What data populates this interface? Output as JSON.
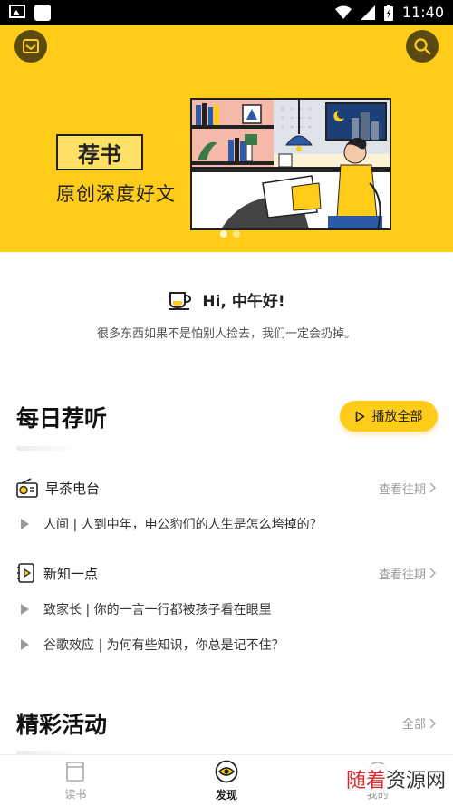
{
  "status_bar": {
    "time": "11:40"
  },
  "banner": {
    "title": "荐书",
    "subtitle": "原创深度好文",
    "colors": {
      "bg": "#FFCC1A",
      "icon_bg": "#5a4a12"
    }
  },
  "greeting": {
    "title": "Hi, 中午好!",
    "subtitle": "很多东西如果不是怕别人捡去，我们一定会扔掉。"
  },
  "daily": {
    "title": "每日荐听",
    "play_all": "播放全部",
    "groups": [
      {
        "name": "早茶电台",
        "more": "查看往期",
        "tracks": [
          "人间 | 人到中年，申公豹们的人生是怎么垮掉的？"
        ]
      },
      {
        "name": "新知一点",
        "more": "查看往期",
        "tracks": [
          "致家长 | 你的一言一行都被孩子看在眼里",
          "谷歌效应 | 为何有些知识，你总是记不住？"
        ]
      }
    ]
  },
  "events": {
    "title": "精彩活动",
    "all": "全部"
  },
  "tabs": [
    {
      "label": "读书",
      "icon": "book-icon"
    },
    {
      "label": "发现",
      "icon": "eye-icon"
    },
    {
      "label": "我的",
      "icon": "user-icon"
    }
  ],
  "watermark": {
    "red": "随着",
    "black": "资源网"
  }
}
